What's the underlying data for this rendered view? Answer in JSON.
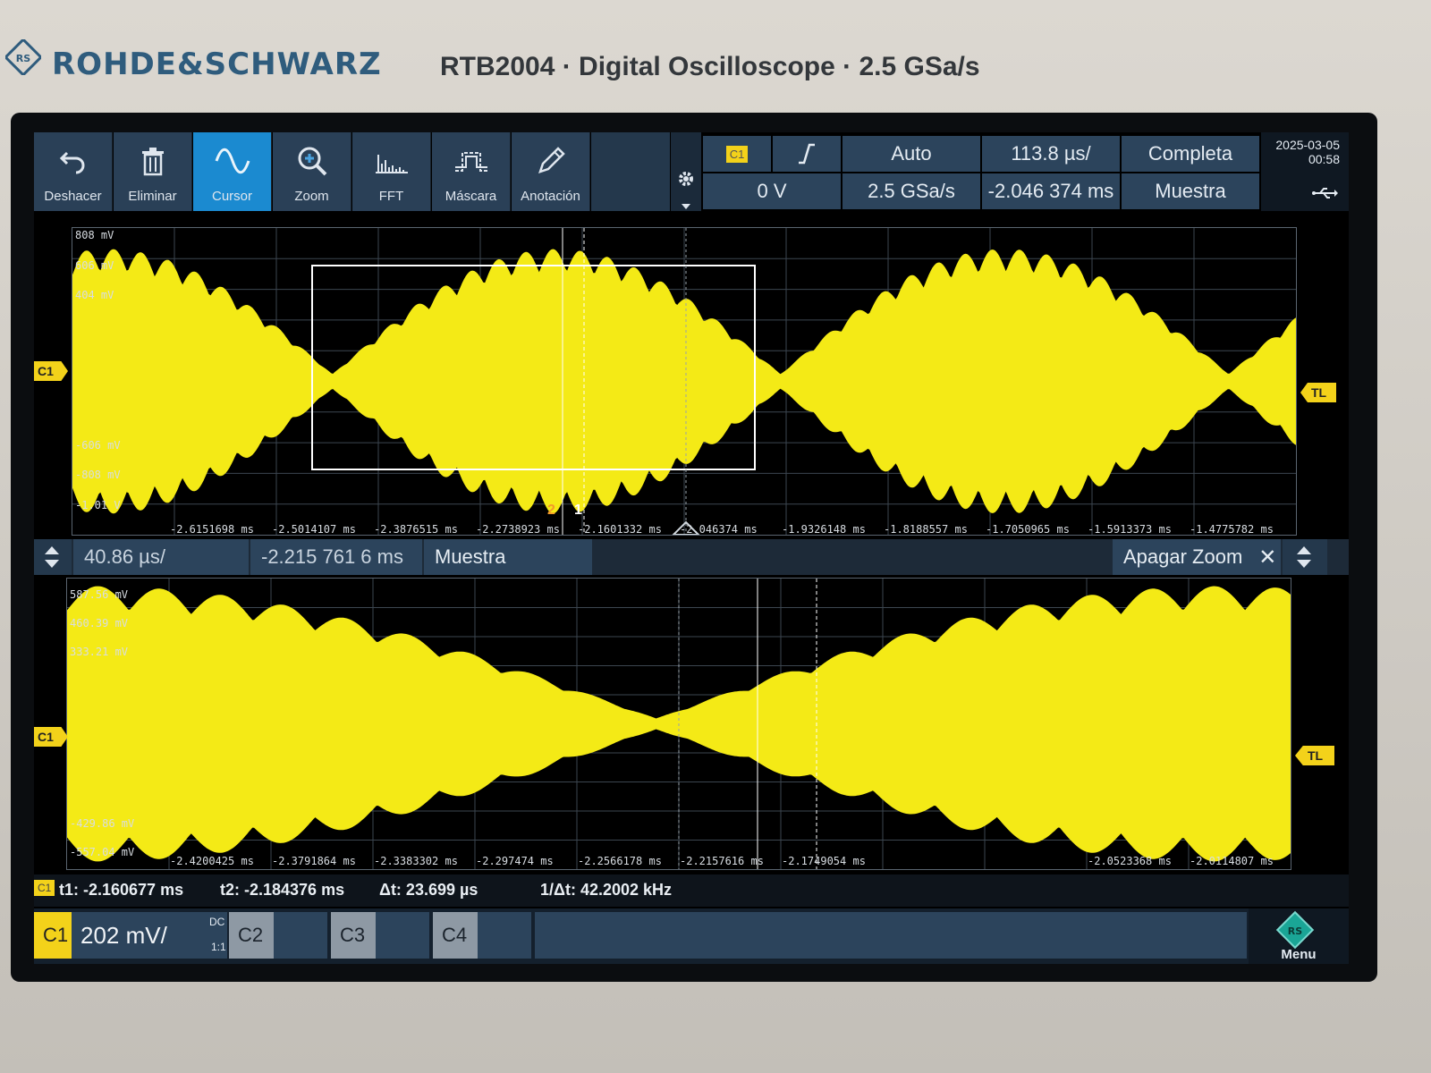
{
  "device": {
    "brand": "ROHDE&SCHWARZ",
    "model_line": "RTB2004 · Digital Oscilloscope · 2.5 GSa/s"
  },
  "toolbar": {
    "undo": "Deshacer",
    "delete": "Eliminar",
    "cursor": "Cursor",
    "zoom": "Zoom",
    "fft": "FFT",
    "mask": "Máscara",
    "annotation": "Anotación",
    "active": "cursor"
  },
  "trigger": {
    "source": "C1",
    "slope": "rising",
    "level": "0 V",
    "mode": "Auto"
  },
  "acquisition": {
    "sample_rate": "2.5 GSa/s",
    "mode": "Completa",
    "type": "Muestra"
  },
  "timebase": {
    "scale": "113.8 µs/",
    "position": "-2.046 374 ms"
  },
  "status": {
    "date": "2025-03-05",
    "time": "00:58"
  },
  "main_view": {
    "channel_marker": "C1",
    "trigger_marker": "TL",
    "cursor1_label": "1",
    "cursor2_label": "2",
    "y_labels": [
      "808 mV",
      "606 mV",
      "404 mV",
      "",
      "",
      "",
      "",
      "-606 mV",
      "-808 mV",
      "-1.01 V"
    ],
    "x_labels": [
      "-2.6151698 ms",
      "-2.5014107 ms",
      "-2.3876515 ms",
      "-2.2738923 ms",
      "-2.1601332 ms",
      "-2.046374 ms",
      "-1.9326148 ms",
      "-1.8188557 ms",
      "-1.7050965 ms",
      "-1.5913373 ms",
      "-1.4775782 ms"
    ]
  },
  "zoom": {
    "scale": "40.86 µs/",
    "position": "-2.215 761 6 ms",
    "type": "Muestra",
    "off_label": "Apagar Zoom"
  },
  "zoom_view": {
    "channel_marker": "C1",
    "trigger_marker": "TL",
    "y_labels": [
      "587.56 mV",
      "460.39 mV",
      "333.21 mV",
      "",
      "",
      "",
      "",
      "",
      "-429.86 mV",
      "-557.04 mV"
    ],
    "x_labels": [
      "-2.4200425 ms",
      "-2.3791864 ms",
      "-2.3383302 ms",
      "-2.297474 ms",
      "-2.2566178 ms",
      "-2.2157616 ms",
      "-2.1749054 ms",
      "",
      "",
      "-2.0523368 ms",
      "-2.0114807 ms"
    ]
  },
  "cursor_readout": {
    "source": "C1",
    "t1": "t1: -2.160677 ms",
    "t2": "t2: -2.184376 ms",
    "delta_t": "Δt: 23.699 µs",
    "inv_delta_t": "1/Δt: 42.2002 kHz"
  },
  "channels": {
    "c1": {
      "name": "C1",
      "scale": "202 mV/",
      "coupling": "DC",
      "probe": "1:1"
    },
    "c2": {
      "name": "C2"
    },
    "c3": {
      "name": "C3"
    },
    "c4": {
      "name": "C4"
    }
  },
  "menu": {
    "label": "Menu"
  },
  "colors": {
    "trace": "#f4ea16",
    "accent": "#1b8ad0",
    "cursor2": "#f39a2a"
  }
}
